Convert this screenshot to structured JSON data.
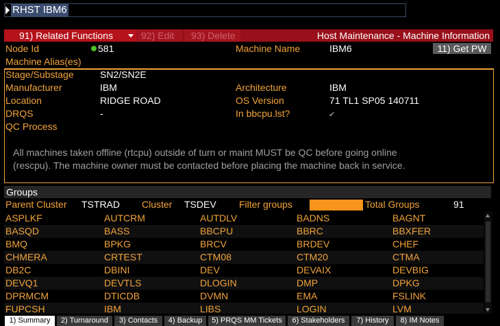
{
  "command": {
    "text": "RHST IBM6"
  },
  "toolbar": {
    "related_functions": "91) Related Functions",
    "edit": "92) Edit",
    "delete": "93) Delete",
    "title": "Host Maintenance - Machine Information"
  },
  "header": {
    "node_id_label": "Node Id",
    "node_id_value": "581",
    "machine_name_label": "Machine Name",
    "machine_name_value": "IBM6",
    "get_pw_label": "11) Get PW",
    "machine_alias_label": "Machine Alias(es)"
  },
  "info": {
    "stage_label": "Stage/Substage",
    "stage_value": "SN2/SN2E",
    "manufacturer_label": "Manufacturer",
    "manufacturer_value": "IBM",
    "architecture_label": "Architecture",
    "architecture_value": "IBM",
    "location_label": "Location",
    "location_value": "RIDGE ROAD",
    "os_label": "OS Version",
    "os_value": "71 TL1 SP05 140711",
    "drqs_label": "DRQS",
    "drqs_value": "-",
    "bbcpu_label": "In bbcpu.lst?",
    "qc_label": "QC Process",
    "note_line1": "All machines taken offline (rtcpu) outside of turn or maint MUST be QC before going online",
    "note_line2": "(rescpu). The machine owner must be contacted before placing the machine back in service."
  },
  "groups": {
    "header": "Groups",
    "parent_cluster_label": "Parent Cluster",
    "parent_cluster_value": "TSTRAD",
    "cluster_label": "Cluster",
    "cluster_value": "TSDEV",
    "filter_label": "Filter groups",
    "total_label": "Total Groups",
    "total_value": "91",
    "rows": [
      [
        "ASPLKF",
        "AUTCRM",
        "AUTDLV",
        "BADNS",
        "BAGNT"
      ],
      [
        "BASQD",
        "BASS",
        "BBCPU",
        "BBRC",
        "BBXFER"
      ],
      [
        "BMQ",
        "BPKG",
        "BRCV",
        "BRDEV",
        "CHEF"
      ],
      [
        "CHMERA",
        "CRTEST",
        "CTM08",
        "CTM20",
        "CTMA"
      ],
      [
        "DB2C",
        "DBINI",
        "DEV",
        "DEVAIX",
        "DEVBIG"
      ],
      [
        "DEVQ1",
        "DEVTLS",
        "DLOGIN",
        "DMP",
        "DPKG"
      ],
      [
        "DPRMCM",
        "DTICDB",
        "DVMN",
        "EMA",
        "FSLINK"
      ],
      [
        "FUPCSH",
        "IBM",
        "LIBS",
        "LOGIN",
        "LVM"
      ]
    ]
  },
  "tabs": [
    "1) Summary",
    "2) Turnaround",
    "3) Contacts",
    "4) Backup",
    "5) PRQS MM Tickets",
    "6) Stakeholders",
    "7) History",
    "8) IM Notes"
  ]
}
